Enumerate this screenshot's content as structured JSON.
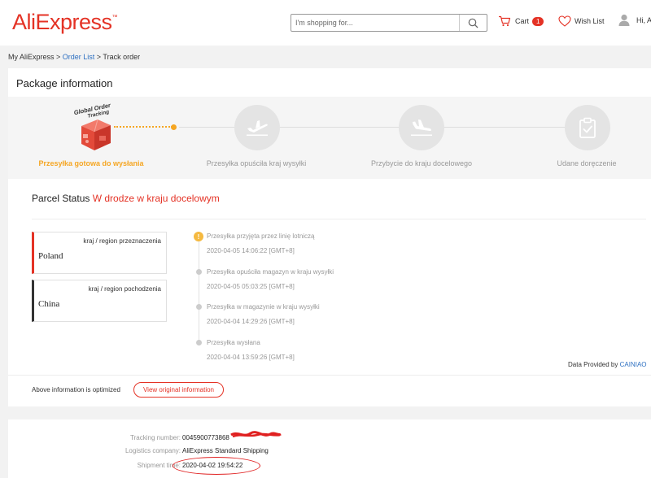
{
  "header": {
    "logo": "AliExpress",
    "logo_tm": "™",
    "search_placeholder": "I'm shopping for...",
    "cart_label": "Cart",
    "cart_count": "1",
    "wishlist_label": "Wish List",
    "user_greeting": "Hi, A"
  },
  "breadcrumb": {
    "home": "My AliExpress",
    "sep1": " > ",
    "order_list": "Order List",
    "sep2": " > ",
    "current": "Track order"
  },
  "package": {
    "title": "Package information",
    "badge_text": "Global Order Tracking",
    "steps": [
      {
        "label": "Przesyłka gotowa do wysłania",
        "active": true
      },
      {
        "label": "Przesyłka opuściła kraj wysyłki",
        "active": false
      },
      {
        "label": "Przybycie do kraju docelowego",
        "active": false
      },
      {
        "label": "Udane doręczenie",
        "active": false
      }
    ]
  },
  "parcel": {
    "status_label": "Parcel Status",
    "status_value": "W drodze w kraju docelowym",
    "destination": {
      "caption": "kraj / region przeznaczenia",
      "country": "Poland"
    },
    "origin": {
      "caption": "kraj / region pochodzenia",
      "country": "China"
    },
    "events": [
      {
        "text": "Przesyłka przyjęta przez linię lotniczą",
        "time": "2020-04-05 14:06:22 [GMT+8]"
      },
      {
        "text": "Przesyłka opuściła magazyn w kraju wysyłki",
        "time": "2020-04-05 05:03:25 [GMT+8]"
      },
      {
        "text": "Przesyłka w magazynie w kraju wysyłki",
        "time": "2020-04-04 14:29:26 [GMT+8]"
      },
      {
        "text": "Przesyłka wysłana",
        "time": "2020-04-04 13:59:26 [GMT+8]"
      }
    ],
    "first_event_icon": "!",
    "provided_by_label": "Data Provided by",
    "provider": "CAINIAO",
    "optimized_note": "Above information is optimized",
    "view_original": "View original information"
  },
  "tracking": {
    "tracking_number_label": "Tracking number:",
    "tracking_number": "0045900773868",
    "logistics_label": "Logistics company:",
    "logistics": "AliExpress Standard Shipping",
    "shipment_label": "Shipment time:",
    "shipment_time": "2020-04-02 19:54:22"
  },
  "colors": {
    "brand_red": "#e43225",
    "progress_orange": "#f5a623",
    "link_blue": "#2c6fc1"
  },
  "icons": {
    "search": "search-icon",
    "cart": "cart-icon",
    "wishlist": "heart-icon",
    "user": "user-icon",
    "step2": "plane-takeoff-icon",
    "step3": "plane-landing-icon",
    "step4": "clipboard-check-icon"
  }
}
